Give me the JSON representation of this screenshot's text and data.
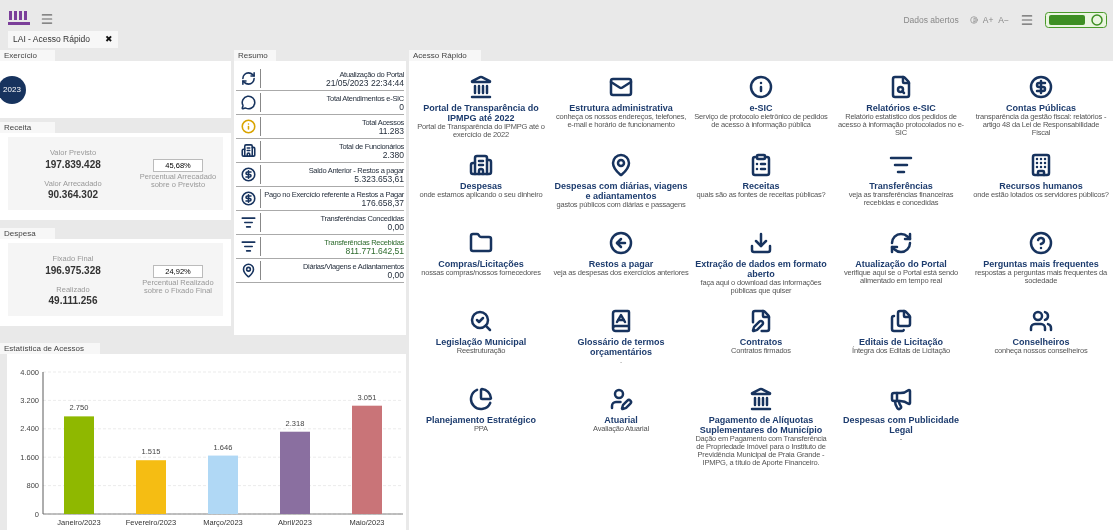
{
  "header": {
    "links": [
      "Dados abertos",
      "A+",
      "A−"
    ]
  },
  "tab": {
    "label": "LAI - Acesso Rápido",
    "close": "✖"
  },
  "exercicio": {
    "title": "Exercício",
    "year": "2023"
  },
  "receita": {
    "title": "Receita",
    "label_1": "Valor Previsto",
    "value_1": "197.839.428",
    "label_2": "Valor Arrecadado",
    "value_2": "90.364.302",
    "percent": "45,68%",
    "percent_label": "Percentual Arrecadado sobre o Previsto"
  },
  "despesa": {
    "title": "Despesa",
    "label_1": "Fixado Final",
    "value_1": "196.975.328",
    "label_2": "Realizado",
    "value_2": "49.111.256",
    "percent": "24,92%",
    "percent_label": "Percentual Realizado sobre o Fixado Final"
  },
  "resumo": {
    "title": "Resumo",
    "rows": [
      {
        "label": "Atualização do Portal",
        "value": "21/05/2023 22:34:44",
        "highlighted": false
      },
      {
        "label": "Total Atendimentos e-SIC",
        "value": "0",
        "highlighted": false
      },
      {
        "label": "Total Acessos",
        "value": "11.283",
        "highlighted": false
      },
      {
        "label": "Total de Funcionários",
        "value": "2.380",
        "highlighted": false
      },
      {
        "label": "Saldo Anterior - Restos a pagar",
        "value": "5.323.653,61",
        "highlighted": false
      },
      {
        "label": "Pago no Exercício referente a Restos a Pagar",
        "value": "176.658,37",
        "highlighted": false
      },
      {
        "label": "Transferências Concedidas",
        "value": "0,00",
        "highlighted": false
      },
      {
        "label": "Transferências Recebidas",
        "value": "811.771.642,51",
        "highlighted": true
      },
      {
        "label": "Diárias/Viagens e Adiantamentos",
        "value": "0,00",
        "highlighted": false
      }
    ]
  },
  "estatistica": {
    "title": "Estatística de Acessos",
    "chart_data": {
      "type": "bar",
      "grid": true,
      "categories": [
        "Janeiro/2023",
        "Fevereiro/2023",
        "Março/2023",
        "Abril/2023",
        "Maio/2023"
      ],
      "series": [
        {
          "values": [
            2750,
            1515,
            1646,
            2318,
            3051
          ]
        }
      ],
      "colors": [
        "#8fb800",
        "#f5bd13",
        "#b0d8f5",
        "#8a6fa0",
        "#c97478"
      ],
      "value_labels": [
        "2.750",
        "1.515",
        "1.646",
        "2.318",
        "3.051"
      ],
      "ylim": [
        0,
        4000
      ],
      "yticks": [
        {
          "value": 0,
          "label": "0"
        },
        {
          "value": 800,
          "label": "800"
        },
        {
          "value": 1600,
          "label": "1.600"
        },
        {
          "value": 2400,
          "label": "2.400"
        },
        {
          "value": 3200,
          "label": "3.200"
        },
        {
          "value": 4000,
          "label": "4.000"
        }
      ]
    }
  },
  "acesso_rapido": {
    "title": "Acesso Rápido",
    "tiles": [
      {
        "title": "Portal de Transparência do IPMPG até 2022",
        "description": "Portal de Transparência do IPMPG até o exercício de 2022"
      },
      {
        "title": "Estrutura administrativa",
        "description": "conheça os nossos endereços, telefones, e-mail e horário de funcionamento"
      },
      {
        "title": "e-SIC",
        "description": "Serviço de protocolo eletrônico de pedidos de acesso à informação pública"
      },
      {
        "title": "Relatórios e-SIC",
        "description": "Relatório estatístico dos pedidos de acesso à informação protocolados no e-SIC"
      },
      {
        "title": "Contas Públicas",
        "description": "transparência da gestão fiscal: relatórios - artigo 48 da Lei de Responsabilidade Fiscal"
      },
      {
        "title": "Despesas",
        "description": "onde estamos aplicando o seu dinheiro"
      },
      {
        "title": "Despesas com diárias, viagens e adiantamentos",
        "description": "gastos públicos com diárias e passagens"
      },
      {
        "title": "Receitas",
        "description": "quais são as fontes de receitas públicas?"
      },
      {
        "title": "Transferências",
        "description": "veja as transferências financeiras recebidas e concedidas"
      },
      {
        "title": "Recursos humanos",
        "description": "onde estão lotados os servidores públicos?"
      },
      {
        "title": "Compras/Licitações",
        "description": "nossas compras/nossos fornecedores"
      },
      {
        "title": "Restos a pagar",
        "description": "veja as despesas dos exercícios anteriores"
      },
      {
        "title": "Extração de dados em formato aberto",
        "description": "faça aqui o download das informações públicas que quiser"
      },
      {
        "title": "Atualização do Portal",
        "description": "verifique aqui se o Portal está sendo alimentado em tempo real"
      },
      {
        "title": "Perguntas mais frequentes",
        "description": "respostas a perguntas mais frequentes da sociedade"
      },
      {
        "title": "Legislação Municipal",
        "description": "Reestruturação"
      },
      {
        "title": "Glossário de termos orçamentários",
        "description": "."
      },
      {
        "title": "Contratos",
        "description": "Contratos firmados"
      },
      {
        "title": "Editais de Licitação",
        "description": "Íntegra dos Editais de Licitação"
      },
      {
        "title": "Conselheiros",
        "description": "conheça nossos conselheiros"
      },
      {
        "title": "Planejamento Estratégico",
        "description": "PPA"
      },
      {
        "title": "Atuarial",
        "description": "Avaliação Atuarial"
      },
      {
        "title": "Pagamento de Alíquotas Suplementares do Município",
        "description": "Dação em Pagamento com Transferência de Propriedade Imóvel para o Instituto de Previdência Municipal de Praia Grande - IPMPG, a título de Aporte Financeiro."
      },
      {
        "title": "Despesas com Publicidade Legal",
        "description": "-"
      }
    ]
  }
}
